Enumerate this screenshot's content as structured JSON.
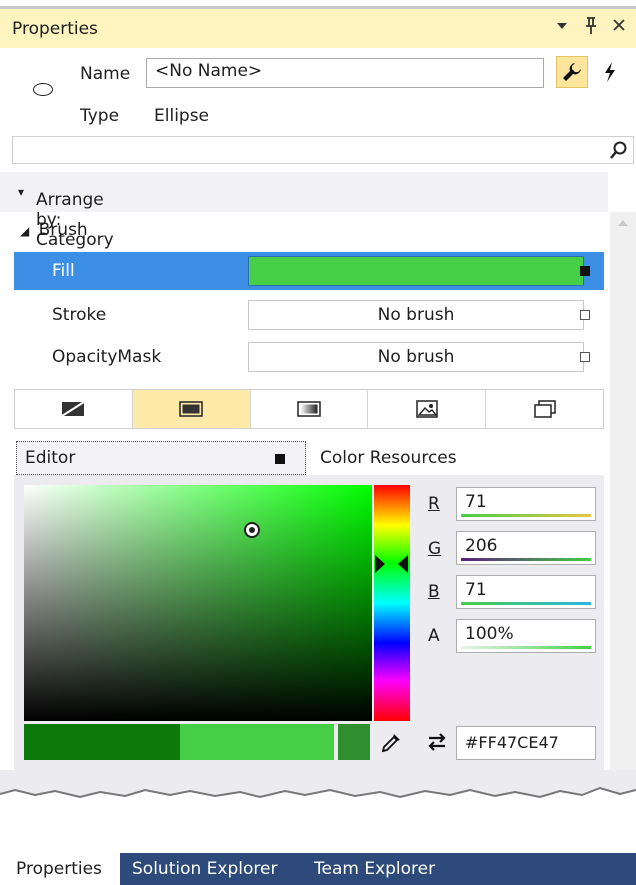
{
  "panel": {
    "title": "Properties",
    "controls": {
      "dropdown": "▾",
      "pin": "ᵖ",
      "close": "✕"
    }
  },
  "header": {
    "name_label": "Name",
    "name_value": "<No Name>",
    "type_label": "Type",
    "type_value": "Ellipse",
    "properties_button_icon": "wrench-icon",
    "events_button_icon": "lightning-icon"
  },
  "search": {
    "placeholder": "",
    "icon": "search-icon"
  },
  "arrange": {
    "label": "Arrange by: Category",
    "caret": "▾"
  },
  "brush": {
    "category": "Brush",
    "properties": [
      {
        "name": "Fill",
        "value": "",
        "selected": true,
        "color": "#47CE47"
      },
      {
        "name": "Stroke",
        "value": "No brush",
        "selected": false
      },
      {
        "name": "OpacityMask",
        "value": "No brush",
        "selected": false
      }
    ],
    "types": [
      {
        "icon": "no-brush-icon",
        "active": false
      },
      {
        "icon": "solid-brush-icon",
        "active": true
      },
      {
        "icon": "gradient-brush-icon",
        "active": false
      },
      {
        "icon": "tile-brush-icon",
        "active": false
      },
      {
        "icon": "resource-brush-icon",
        "active": false
      }
    ]
  },
  "editor": {
    "tabs": {
      "editor": "Editor",
      "resources": "Color Resources"
    },
    "channels": [
      {
        "label": "R",
        "value": "71"
      },
      {
        "label": "G",
        "value": "206"
      },
      {
        "label": "B",
        "value": "71"
      },
      {
        "label": "A",
        "value": "100%"
      }
    ],
    "hex": "#FF47CE47",
    "swatches": {
      "initial": "#0b7a0b",
      "current": "#47CE47",
      "last": "#2f8f2f"
    }
  },
  "bottom_tabs": [
    {
      "label": "Properties",
      "active": true
    },
    {
      "label": "Solution Explorer",
      "active": false
    },
    {
      "label": "Team Explorer",
      "active": false
    }
  ],
  "colors": {
    "title_bg": "#fdf4bf",
    "selection": "#3d8fe6",
    "active_tab": "#fde9a8",
    "bottom_bar": "#2d4a7a"
  }
}
